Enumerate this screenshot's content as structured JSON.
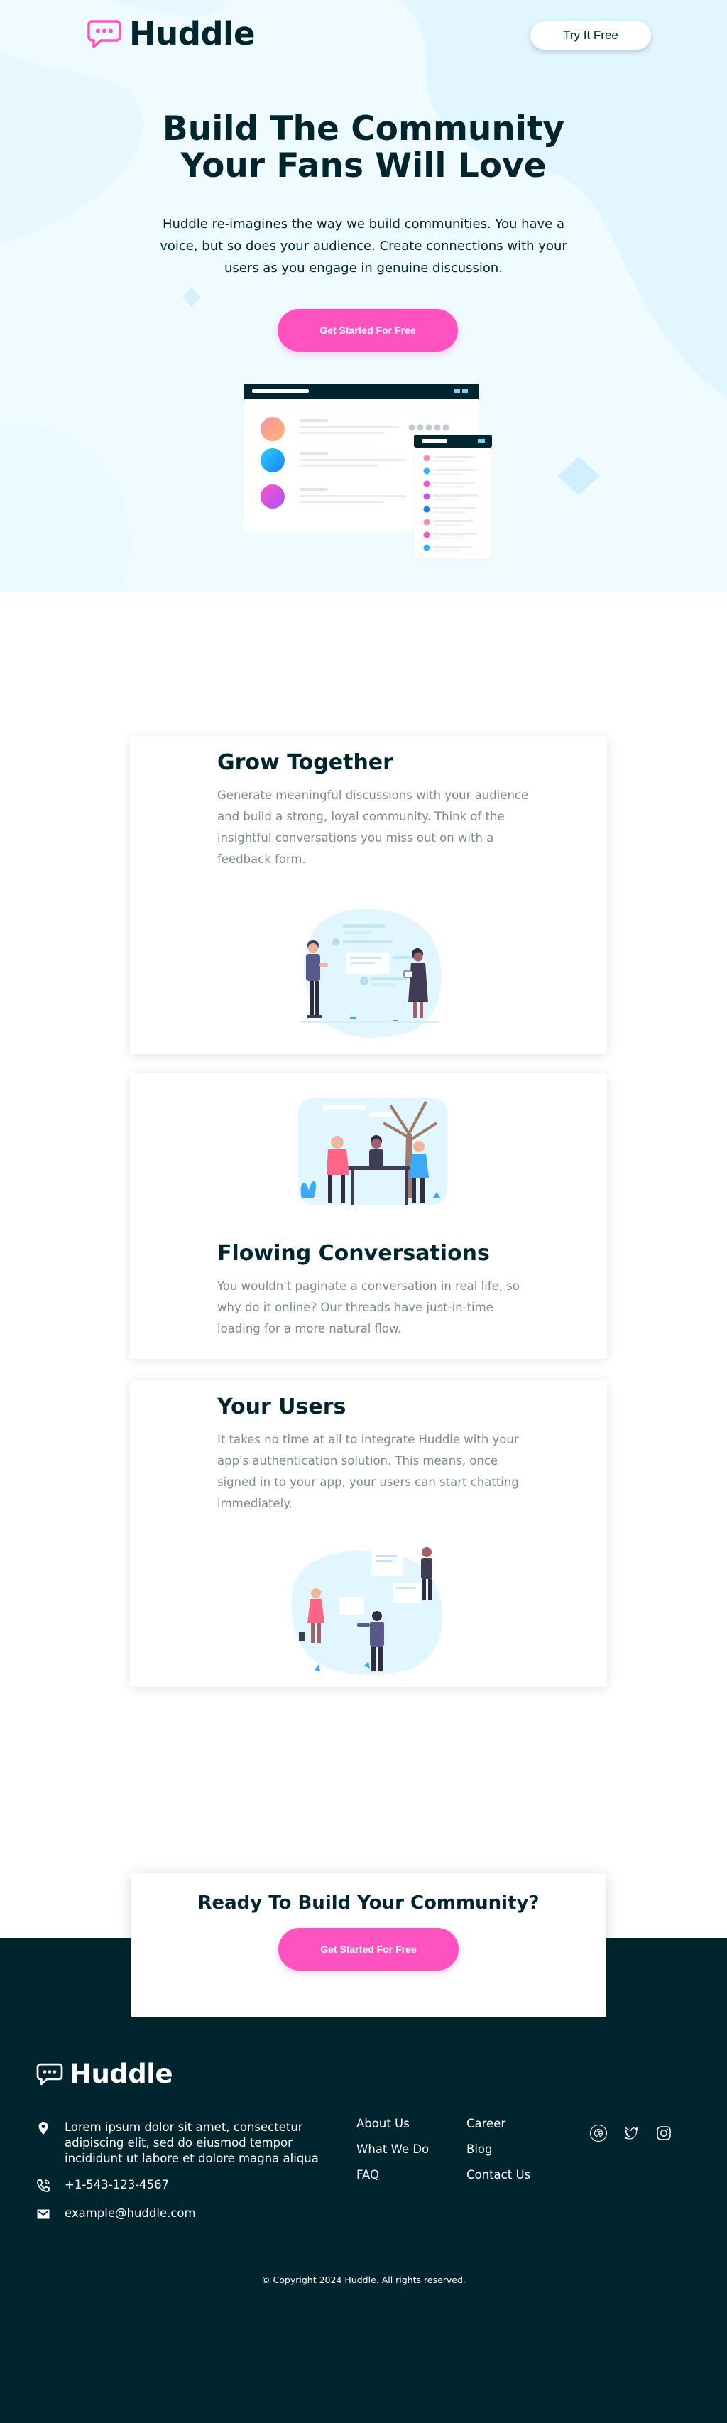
{
  "brand": {
    "name": "Huddle",
    "logo_icon": "speech-bubble-icon",
    "colors": {
      "primary_dark": "#00252e",
      "accent_pink": "#ff52c1",
      "hero_bg": "#f0fbff",
      "text_gray": "#7b8a8e"
    }
  },
  "header": {
    "try_button": "Try It Free"
  },
  "hero": {
    "title_line1": "Build The Community",
    "title_line2": "Your Fans Will Love",
    "description": "Huddle re-imagines the way we build communities. You have a voice, but so does your audience. Create connections with your users as you engage in genuine discussion.",
    "cta": "Get Started For Free"
  },
  "features": [
    {
      "title": "Grow Together",
      "text": "Generate meaningful discussions with your audience and build a strong, loyal community. Think of the insightful conversations you miss out on with a feedback form.",
      "illustration": "grow-together-illustration"
    },
    {
      "title": "Flowing Conversations",
      "text": "You wouldn't paginate a conversation in real life, so why do it online? Our threads have just-in-time loading for a more natural flow.",
      "illustration": "flowing-conversations-illustration"
    },
    {
      "title": "Your Users",
      "text": "It takes no time at all to integrate Huddle with your app's authentication solution. This means, once signed in to your app, your users can start chatting immediately.",
      "illustration": "your-users-illustration"
    }
  ],
  "cta_section": {
    "title": "Ready To Build Your Community?",
    "button": "Get Started For Free"
  },
  "footer": {
    "brand": "Huddle",
    "address": "Lorem ipsum dolor sit amet, consectetur adipiscing elit, sed do eiusmod tempor incididunt ut labore et dolore magna aliqua",
    "phone": "+1-543-123-4567",
    "email": "example@huddle.com",
    "links_col1": [
      "About Us",
      "What We Do",
      "FAQ"
    ],
    "links_col2": [
      "Career",
      "Blog",
      "Contact Us"
    ],
    "social": [
      "dribbble-icon",
      "twitter-icon",
      "instagram-icon"
    ],
    "copyright": "© Copyright 2024 Huddle. All rights reserved."
  }
}
